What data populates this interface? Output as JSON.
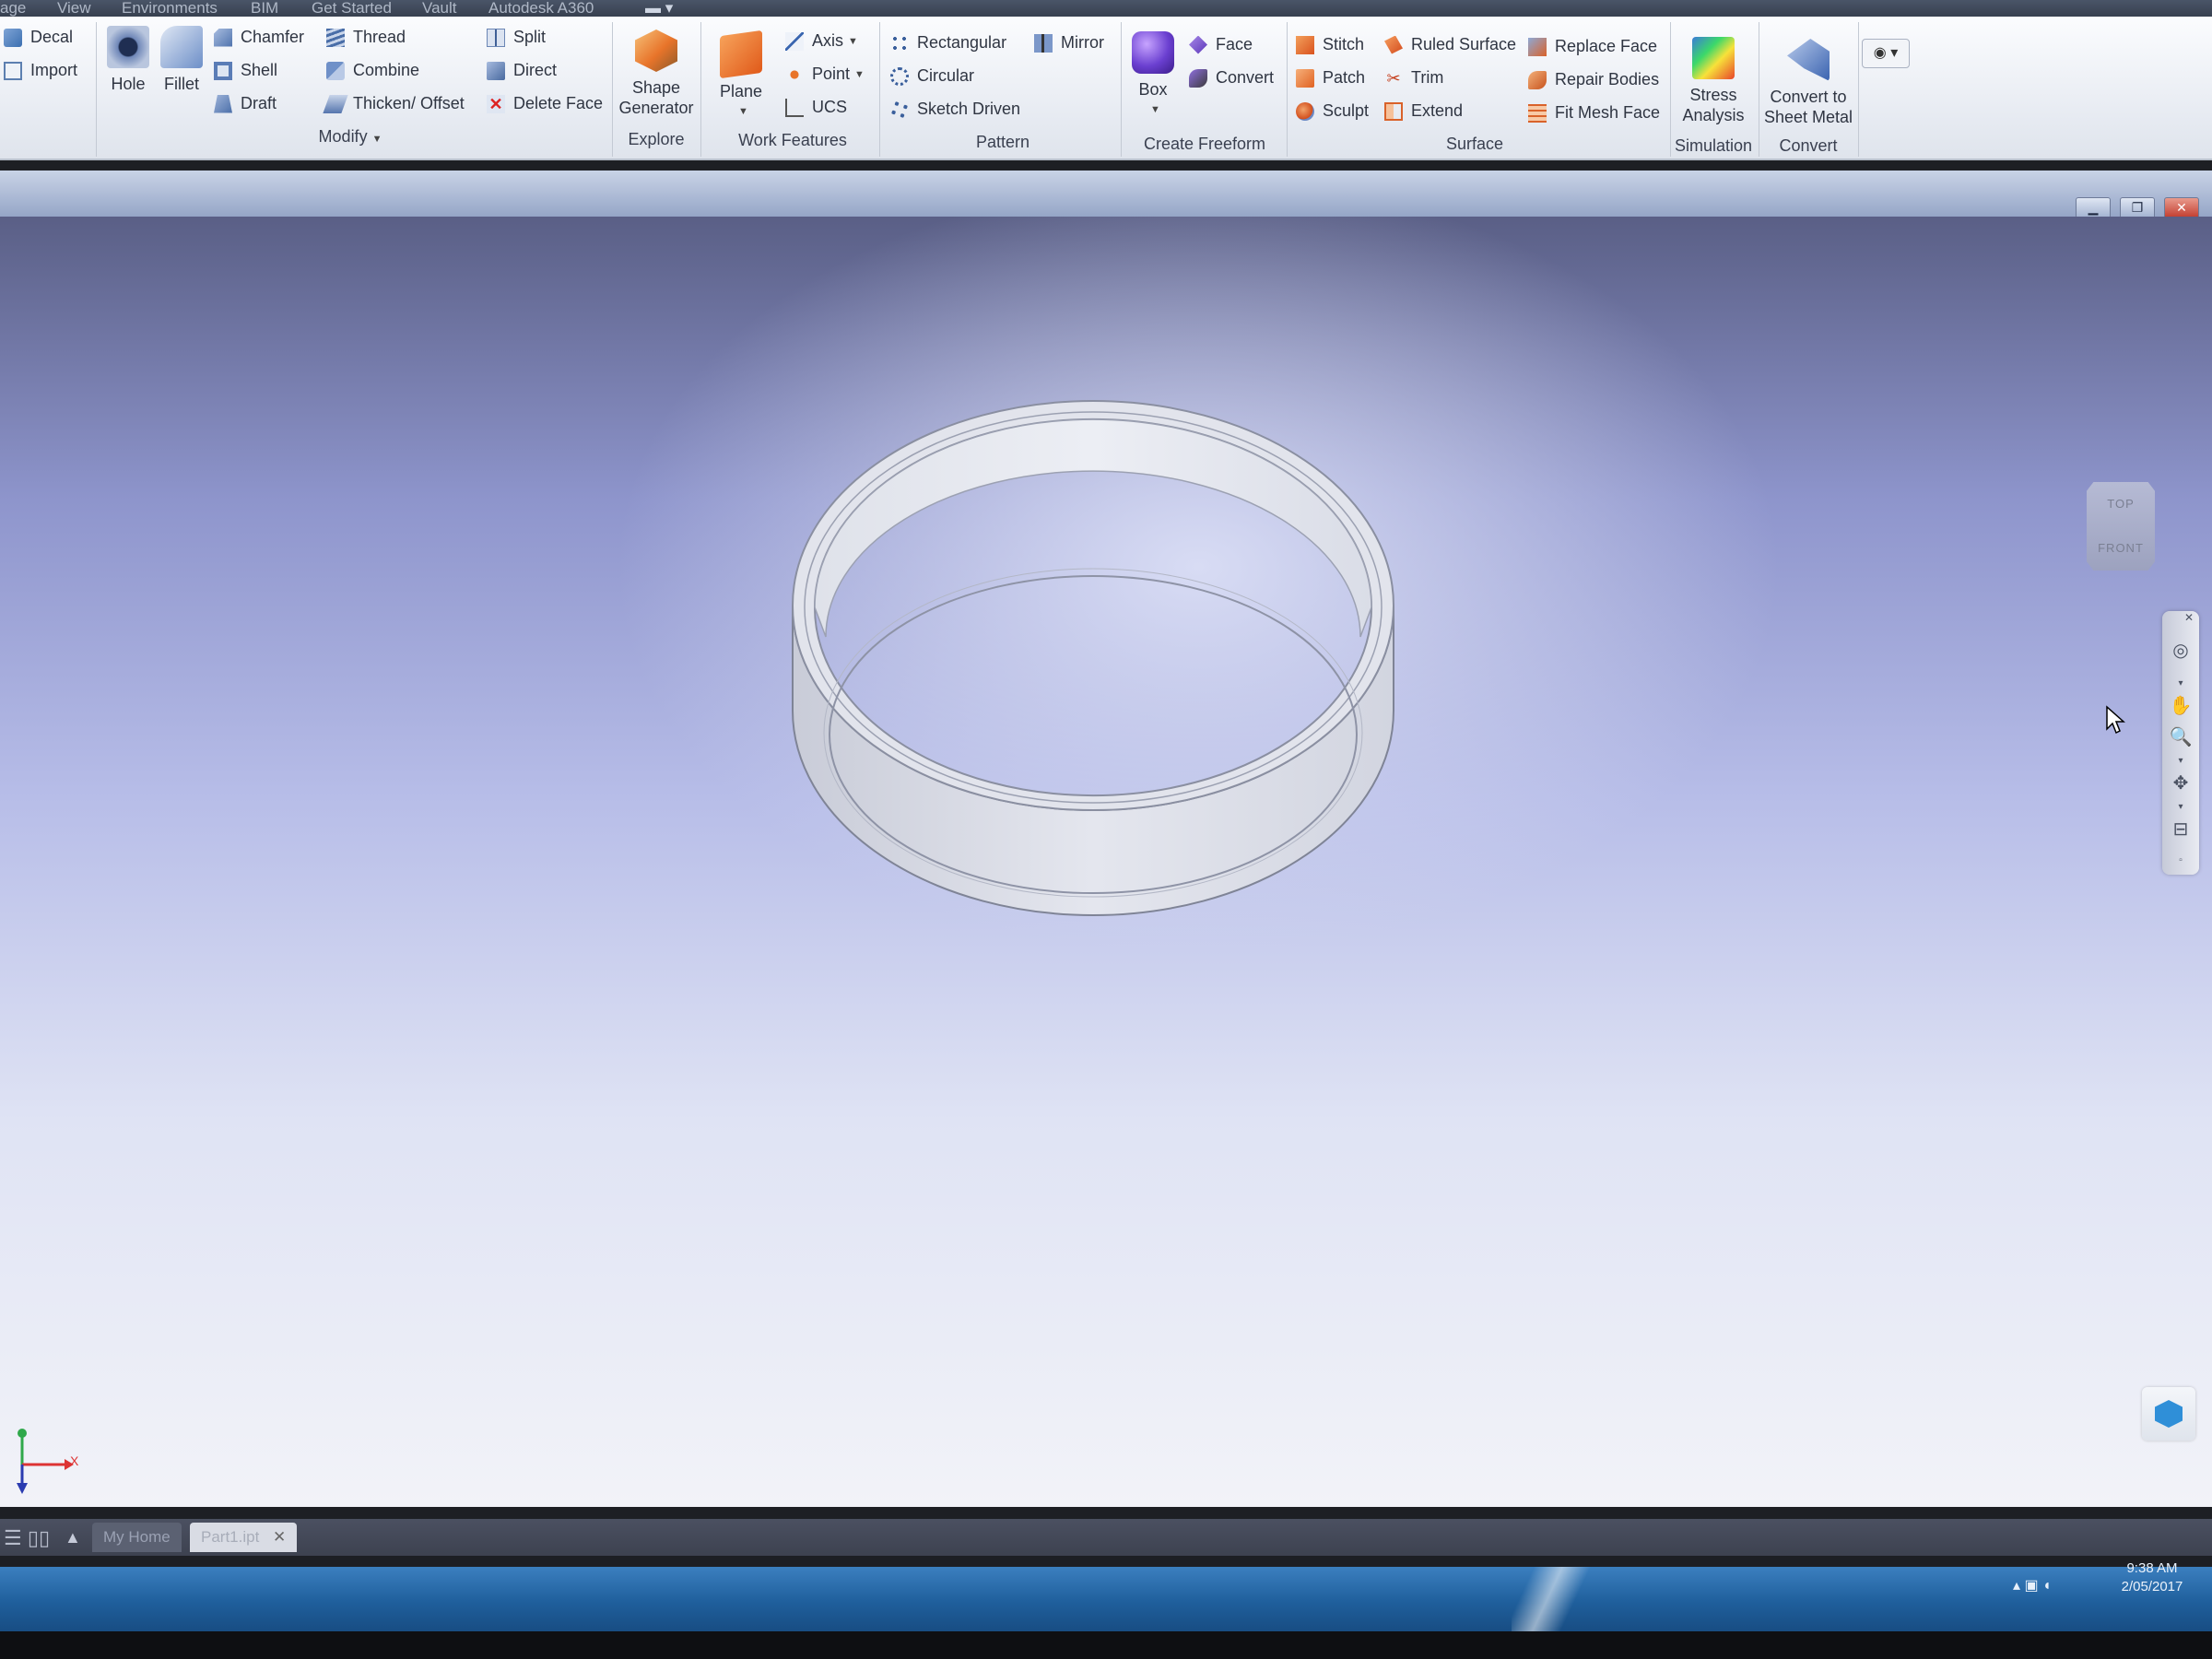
{
  "menu_tabs": [
    "age",
    "View",
    "Environments",
    "BIM",
    "Get Started",
    "Vault",
    "Autodesk A360"
  ],
  "ribbon": {
    "panels": {
      "modify": "Modify",
      "explore": "Explore",
      "work_features": "Work Features",
      "pattern": "Pattern",
      "create_freeform": "Create Freeform",
      "surface": "Surface",
      "simulation": "Simulation",
      "convert": "Convert"
    },
    "insert": {
      "decal": "Decal",
      "import": "Import"
    },
    "modify_items": {
      "hole": "Hole",
      "fillet": "Fillet",
      "chamfer": "Chamfer",
      "shell": "Shell",
      "draft": "Draft",
      "thread": "Thread",
      "combine": "Combine",
      "thicken_offset": "Thicken/ Offset",
      "split": "Split",
      "direct": "Direct",
      "delete_face": "Delete Face"
    },
    "explore_items": {
      "shape_generator_1": "Shape",
      "shape_generator_2": "Generator"
    },
    "work_items": {
      "plane": "Plane",
      "axis": "Axis",
      "point": "Point",
      "ucs": "UCS"
    },
    "pattern_items": {
      "rectangular": "Rectangular",
      "circular": "Circular",
      "sketch_driven": "Sketch Driven",
      "mirror": "Mirror"
    },
    "freeform_items": {
      "box": "Box",
      "face": "Face",
      "convert": "Convert"
    },
    "surface_items": {
      "stitch": "Stitch",
      "patch": "Patch",
      "sculpt": "Sculpt",
      "ruled_surface": "Ruled Surface",
      "trim": "Trim",
      "extend": "Extend",
      "replace_face": "Replace Face",
      "repair_bodies": "Repair Bodies",
      "fit_mesh_face": "Fit Mesh Face"
    },
    "simulation_items": {
      "stress_1": "Stress",
      "stress_2": "Analysis"
    },
    "convert_items": {
      "sheet_1": "Convert to",
      "sheet_2": "Sheet Metal"
    }
  },
  "viewcube": {
    "top": "TOP",
    "front": "FRONT"
  },
  "triad": {
    "x": "X"
  },
  "doc_tabs": {
    "home": "My Home",
    "part": "Part1.ipt"
  },
  "taskbar": {
    "time": "9:38 AM",
    "date": "2/05/2017"
  },
  "icons": [
    "decal-icon",
    "import-icon",
    "hole-icon",
    "fillet-icon",
    "chamfer-icon",
    "shell-icon",
    "draft-icon",
    "thread-icon",
    "combine-icon",
    "thicken-icon",
    "split-icon",
    "direct-icon",
    "delete-face-icon",
    "shape-generator-icon",
    "plane-icon",
    "axis-icon",
    "point-icon",
    "ucs-icon",
    "rectangular-pattern-icon",
    "circular-pattern-icon",
    "sketch-driven-icon",
    "mirror-icon",
    "box-icon",
    "face-icon",
    "convert-icon",
    "stitch-icon",
    "patch-icon",
    "sculpt-icon",
    "ruled-surface-icon",
    "trim-icon",
    "extend-icon",
    "replace-face-icon",
    "repair-bodies-icon",
    "fit-mesh-face-icon",
    "stress-analysis-icon",
    "sheet-metal-icon"
  ],
  "colors": {
    "accent_blue": "#2f6fb8",
    "orange": "#e8742a",
    "purple": "#6a3fd0",
    "viewport_top": "#5a5f86",
    "viewport_bottom": "#f2f3f8"
  }
}
